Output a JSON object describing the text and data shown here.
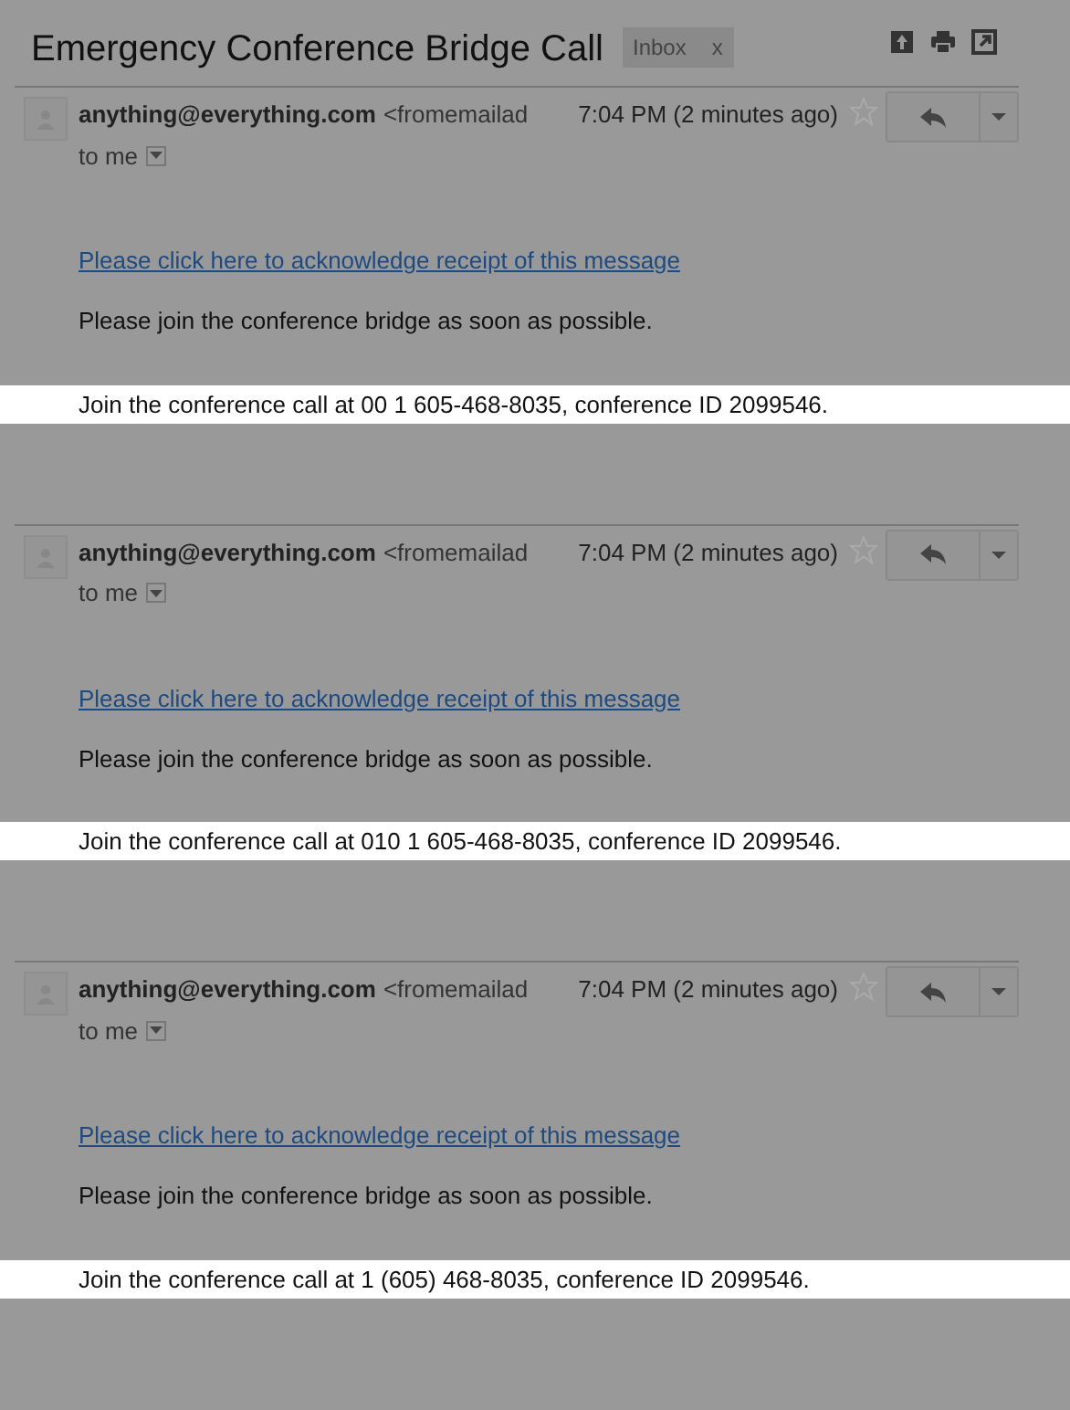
{
  "subject": "Emergency Conference Bridge Call",
  "label": {
    "text": "Inbox",
    "remove": "x"
  },
  "messages": [
    {
      "sender": "anything@everything.com",
      "address": "<fromemailad",
      "time": "7:04 PM (2 minutes ago)",
      "starred": false,
      "recipient": "to me",
      "link": "Please click here to acknowledge receipt of this message",
      "body": "Please join the conference bridge as soon as possible.",
      "highlight": "Join the conference call at 00 1 605-468-8035, conference ID 2099546."
    },
    {
      "sender": "anything@everything.com",
      "address": "<fromemailad",
      "time": "7:04 PM (2 minutes ago)",
      "starred": false,
      "recipient": "to me",
      "link": "Please click here to acknowledge receipt of this message",
      "body": "Please join the conference bridge as soon as possible.",
      "highlight": "Join the conference call at 010 1 605-468-8035, conference ID 2099546."
    },
    {
      "sender": "anything@everything.com",
      "address": "<fromemailad",
      "time": "7:04 PM (2 minutes ago)",
      "starred": false,
      "recipient": "to me",
      "link": "Please click here to acknowledge receipt of this message",
      "body": "Please join the conference bridge as soon as possible.",
      "highlight": "Join the conference call at 1 (605) 468-8035, conference ID 2099546."
    }
  ]
}
